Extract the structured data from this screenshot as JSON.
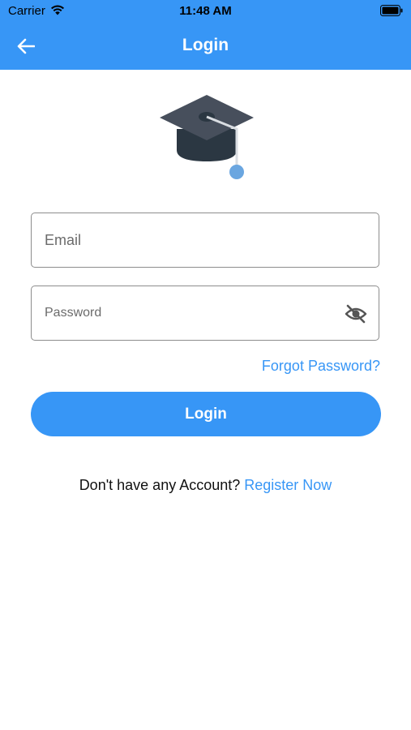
{
  "status_bar": {
    "carrier": "Carrier",
    "time": "11:48 AM"
  },
  "nav": {
    "title": "Login",
    "back_icon": "arrow-left-icon"
  },
  "logo": {
    "icon": "graduation-cap-icon"
  },
  "form": {
    "email_placeholder": "Email",
    "password_placeholder": "Password",
    "password_toggle_icon": "eye-off-icon",
    "forgot_label": "Forgot Password?",
    "login_label": "Login"
  },
  "register": {
    "prompt": "Don't have any Account?",
    "link_label": "Register Now"
  },
  "colors": {
    "primary": "#3796f6",
    "cap_dark": "#474f5c",
    "cap_base": "#2b3742",
    "tassel": "#6aa6e0"
  }
}
